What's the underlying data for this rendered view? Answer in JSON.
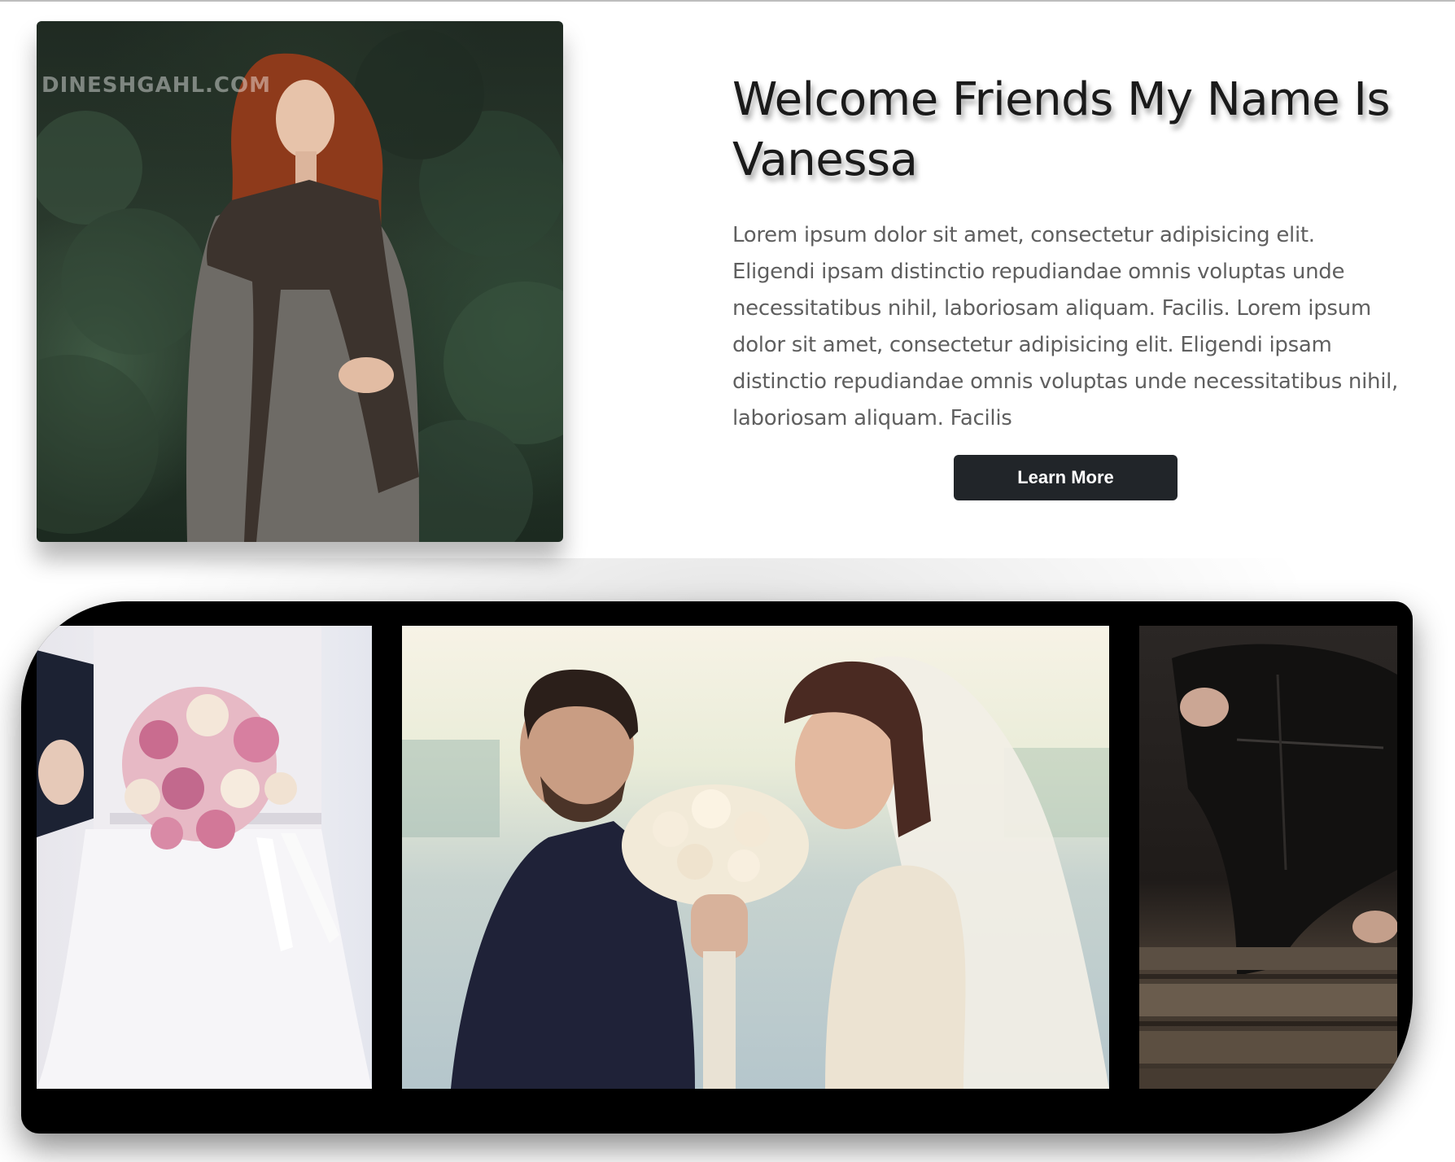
{
  "hero": {
    "watermark": "DINESHGAHL.COM",
    "portrait_alt": "Woman with red curly hair in a knitted shawl standing among evergreen bushes"
  },
  "intro": {
    "headline": "Welcome Friends My Name Is Vanessa",
    "body": "Lorem ipsum dolor sit amet, consectetur adipisicing elit. Eligendi ipsam distinctio repudiandae omnis voluptas unde necessitatibus nihil, laboriosam aliquam. Facilis. Lorem ipsum dolor sit amet, consectetur adipisicing elit. Eligendi ipsam distinctio repudiandae omnis voluptas unde necessitatibus nihil, laboriosam aliquam. Facilis",
    "button_label": "Learn More"
  },
  "gallery": {
    "photos": [
      {
        "alt": "Bride in a white lace gown holding a bouquet of pink and cream roses"
      },
      {
        "alt": "Bride and groom smelling a bouquet of cream roses together"
      },
      {
        "alt": "Person in a black leather jacket lying on a wooden dock"
      }
    ]
  },
  "colors": {
    "button_bg": "#212529",
    "button_text": "#ffffff",
    "gallery_frame": "#000000",
    "body_text": "#5f5f5f",
    "headline_text": "#1a1a1a"
  }
}
